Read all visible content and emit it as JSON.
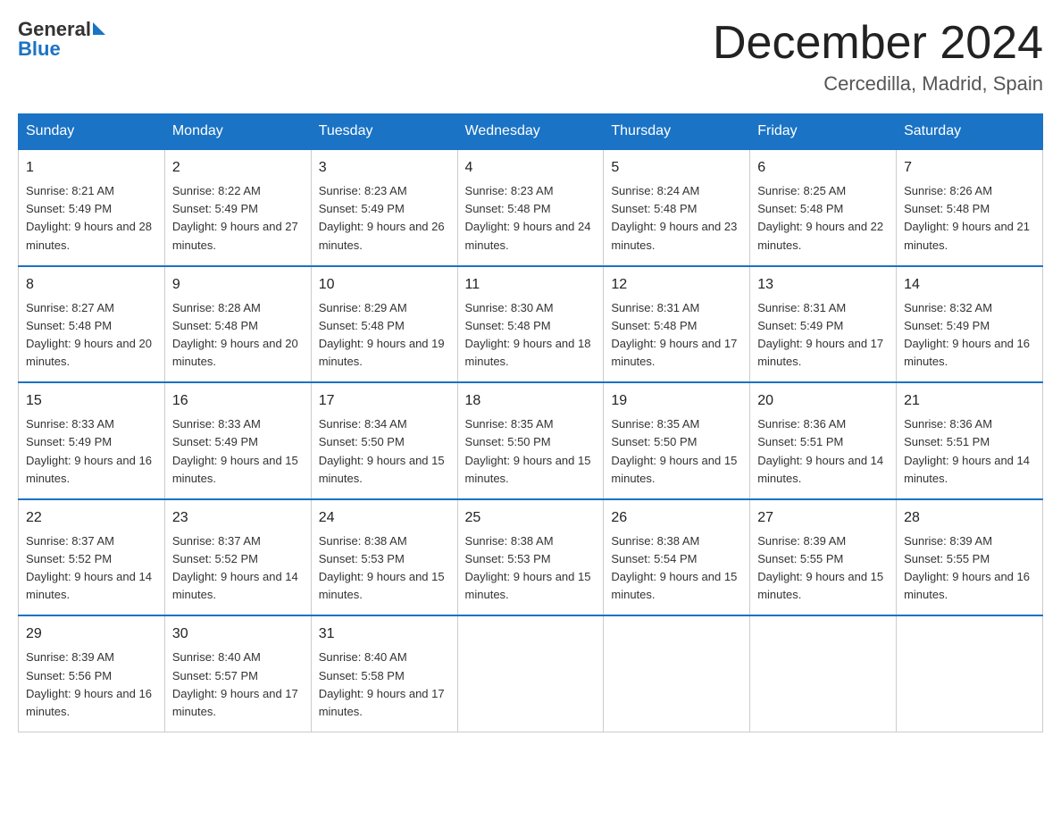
{
  "header": {
    "logo_line1": "General",
    "logo_line2": "Blue",
    "title": "December 2024",
    "subtitle": "Cercedilla, Madrid, Spain"
  },
  "days_of_week": [
    "Sunday",
    "Monday",
    "Tuesday",
    "Wednesday",
    "Thursday",
    "Friday",
    "Saturday"
  ],
  "weeks": [
    [
      {
        "day": "1",
        "sunrise": "8:21 AM",
        "sunset": "5:49 PM",
        "daylight": "9 hours and 28 minutes."
      },
      {
        "day": "2",
        "sunrise": "8:22 AM",
        "sunset": "5:49 PM",
        "daylight": "9 hours and 27 minutes."
      },
      {
        "day": "3",
        "sunrise": "8:23 AM",
        "sunset": "5:49 PM",
        "daylight": "9 hours and 26 minutes."
      },
      {
        "day": "4",
        "sunrise": "8:23 AM",
        "sunset": "5:48 PM",
        "daylight": "9 hours and 24 minutes."
      },
      {
        "day": "5",
        "sunrise": "8:24 AM",
        "sunset": "5:48 PM",
        "daylight": "9 hours and 23 minutes."
      },
      {
        "day": "6",
        "sunrise": "8:25 AM",
        "sunset": "5:48 PM",
        "daylight": "9 hours and 22 minutes."
      },
      {
        "day": "7",
        "sunrise": "8:26 AM",
        "sunset": "5:48 PM",
        "daylight": "9 hours and 21 minutes."
      }
    ],
    [
      {
        "day": "8",
        "sunrise": "8:27 AM",
        "sunset": "5:48 PM",
        "daylight": "9 hours and 20 minutes."
      },
      {
        "day": "9",
        "sunrise": "8:28 AM",
        "sunset": "5:48 PM",
        "daylight": "9 hours and 20 minutes."
      },
      {
        "day": "10",
        "sunrise": "8:29 AM",
        "sunset": "5:48 PM",
        "daylight": "9 hours and 19 minutes."
      },
      {
        "day": "11",
        "sunrise": "8:30 AM",
        "sunset": "5:48 PM",
        "daylight": "9 hours and 18 minutes."
      },
      {
        "day": "12",
        "sunrise": "8:31 AM",
        "sunset": "5:48 PM",
        "daylight": "9 hours and 17 minutes."
      },
      {
        "day": "13",
        "sunrise": "8:31 AM",
        "sunset": "5:49 PM",
        "daylight": "9 hours and 17 minutes."
      },
      {
        "day": "14",
        "sunrise": "8:32 AM",
        "sunset": "5:49 PM",
        "daylight": "9 hours and 16 minutes."
      }
    ],
    [
      {
        "day": "15",
        "sunrise": "8:33 AM",
        "sunset": "5:49 PM",
        "daylight": "9 hours and 16 minutes."
      },
      {
        "day": "16",
        "sunrise": "8:33 AM",
        "sunset": "5:49 PM",
        "daylight": "9 hours and 15 minutes."
      },
      {
        "day": "17",
        "sunrise": "8:34 AM",
        "sunset": "5:50 PM",
        "daylight": "9 hours and 15 minutes."
      },
      {
        "day": "18",
        "sunrise": "8:35 AM",
        "sunset": "5:50 PM",
        "daylight": "9 hours and 15 minutes."
      },
      {
        "day": "19",
        "sunrise": "8:35 AM",
        "sunset": "5:50 PM",
        "daylight": "9 hours and 15 minutes."
      },
      {
        "day": "20",
        "sunrise": "8:36 AM",
        "sunset": "5:51 PM",
        "daylight": "9 hours and 14 minutes."
      },
      {
        "day": "21",
        "sunrise": "8:36 AM",
        "sunset": "5:51 PM",
        "daylight": "9 hours and 14 minutes."
      }
    ],
    [
      {
        "day": "22",
        "sunrise": "8:37 AM",
        "sunset": "5:52 PM",
        "daylight": "9 hours and 14 minutes."
      },
      {
        "day": "23",
        "sunrise": "8:37 AM",
        "sunset": "5:52 PM",
        "daylight": "9 hours and 14 minutes."
      },
      {
        "day": "24",
        "sunrise": "8:38 AM",
        "sunset": "5:53 PM",
        "daylight": "9 hours and 15 minutes."
      },
      {
        "day": "25",
        "sunrise": "8:38 AM",
        "sunset": "5:53 PM",
        "daylight": "9 hours and 15 minutes."
      },
      {
        "day": "26",
        "sunrise": "8:38 AM",
        "sunset": "5:54 PM",
        "daylight": "9 hours and 15 minutes."
      },
      {
        "day": "27",
        "sunrise": "8:39 AM",
        "sunset": "5:55 PM",
        "daylight": "9 hours and 15 minutes."
      },
      {
        "day": "28",
        "sunrise": "8:39 AM",
        "sunset": "5:55 PM",
        "daylight": "9 hours and 16 minutes."
      }
    ],
    [
      {
        "day": "29",
        "sunrise": "8:39 AM",
        "sunset": "5:56 PM",
        "daylight": "9 hours and 16 minutes."
      },
      {
        "day": "30",
        "sunrise": "8:40 AM",
        "sunset": "5:57 PM",
        "daylight": "9 hours and 17 minutes."
      },
      {
        "day": "31",
        "sunrise": "8:40 AM",
        "sunset": "5:58 PM",
        "daylight": "9 hours and 17 minutes."
      },
      null,
      null,
      null,
      null
    ]
  ]
}
